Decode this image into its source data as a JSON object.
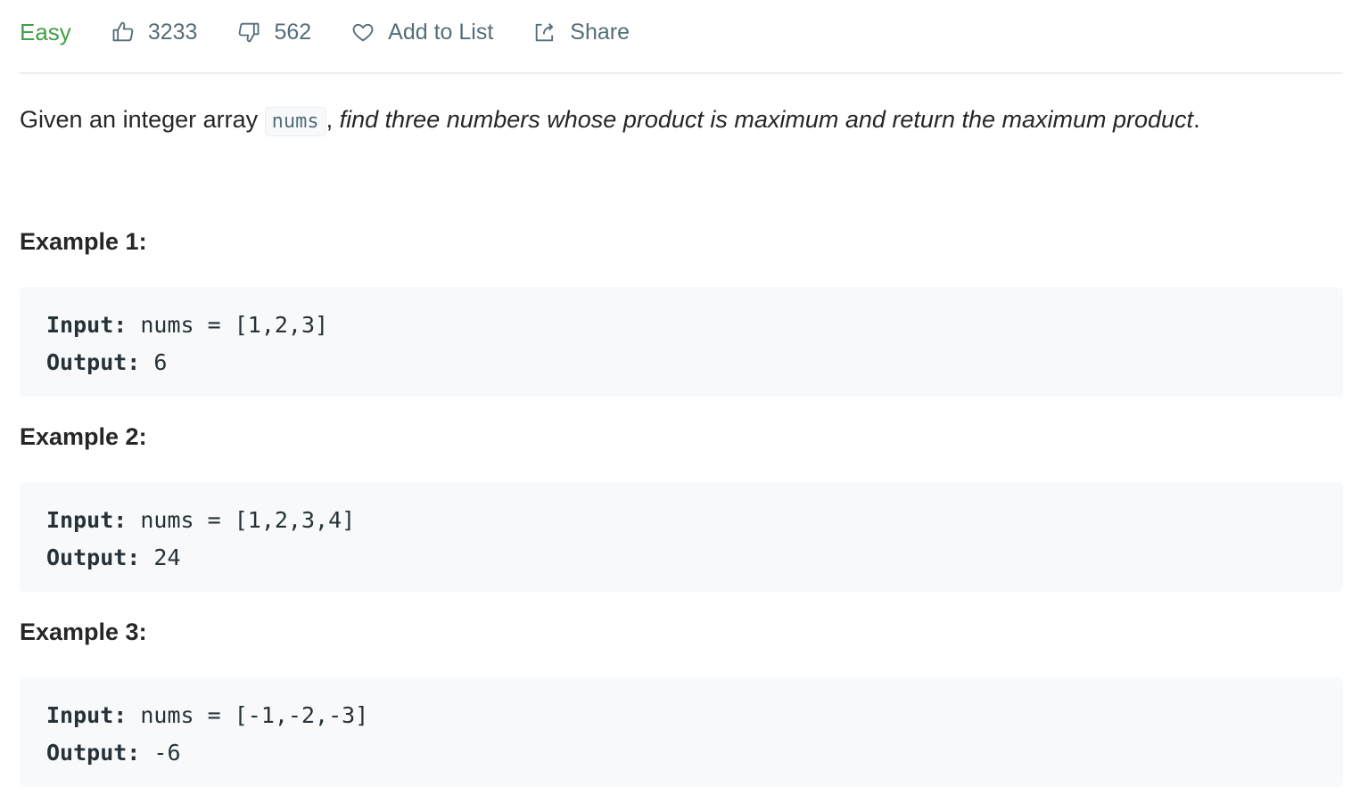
{
  "toolbar": {
    "difficulty": "Easy",
    "likes": "3233",
    "dislikes": "562",
    "add_to_list": "Add to List",
    "share": "Share"
  },
  "description": {
    "prefix": "Given an integer array ",
    "code": "nums",
    "sep": ", ",
    "italic": "find three numbers whose product is maximum and return the maximum product",
    "suffix": "."
  },
  "examples": [
    {
      "title": "Example 1:",
      "input_label": "Input:",
      "input_value": " nums = [1,2,3]",
      "output_label": "Output:",
      "output_value": " 6"
    },
    {
      "title": "Example 2:",
      "input_label": "Input:",
      "input_value": " nums = [1,2,3,4]",
      "output_label": "Output:",
      "output_value": " 24"
    },
    {
      "title": "Example 3:",
      "input_label": "Input:",
      "input_value": " nums = [-1,-2,-3]",
      "output_label": "Output:",
      "output_value": " -6"
    }
  ],
  "colors": {
    "difficulty_easy": "#43a047",
    "toolbar_text": "#546e7a",
    "code_bg": "#f7f9fa"
  },
  "icons": {
    "like": "thumbs-up-icon",
    "dislike": "thumbs-down-icon",
    "favorite": "heart-icon",
    "share": "share-icon"
  }
}
